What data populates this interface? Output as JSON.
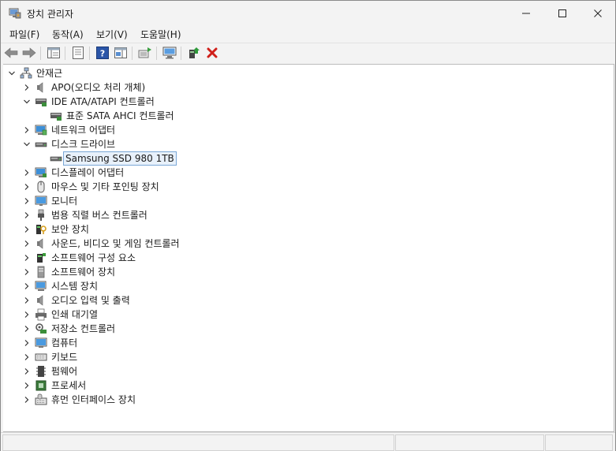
{
  "window": {
    "title": "장치 관리자",
    "icon": "device-manager-icon",
    "controls": [
      "minimize-icon",
      "maximize-icon",
      "close-icon"
    ]
  },
  "menu": [
    {
      "label": "파일(F)"
    },
    {
      "label": "동작(A)"
    },
    {
      "label": "보기(V)"
    },
    {
      "label": "도움말(H)"
    }
  ],
  "toolbar": {
    "buttons": [
      "back-arrow-icon",
      "forward-arrow-icon",
      "show-hide-tree-icon",
      "properties-icon",
      "help-icon",
      "action-pane-icon",
      "update-driver-icon",
      "scan-hardware-icon",
      "add-driver-icon",
      "uninstall-device-icon"
    ]
  },
  "tree": {
    "root": {
      "label": "안재근",
      "icon": "computer-tree-icon",
      "expanded": true
    },
    "nodes": [
      {
        "label": "APO(오디오 처리 개체)",
        "icon": "speaker-icon",
        "level": 1,
        "expanded": false
      },
      {
        "label": "IDE ATA/ATAPI 컨트롤러",
        "icon": "ide-controller-icon",
        "level": 1,
        "expanded": true
      },
      {
        "label": "표준 SATA AHCI 컨트롤러",
        "icon": "ide-controller-icon",
        "level": 2
      },
      {
        "label": "네트워크 어댑터",
        "icon": "network-adapter-icon",
        "level": 1,
        "expanded": false
      },
      {
        "label": "디스크 드라이브",
        "icon": "disk-drive-icon",
        "level": 1,
        "expanded": true
      },
      {
        "label": "Samsung SSD 980 1TB",
        "icon": "disk-drive-icon",
        "level": 2,
        "selected": true
      },
      {
        "label": "디스플레이 어댑터",
        "icon": "display-adapter-icon",
        "level": 1,
        "expanded": false
      },
      {
        "label": "마우스 및 기타 포인팅 장치",
        "icon": "mouse-icon",
        "level": 1,
        "expanded": false
      },
      {
        "label": "모니터",
        "icon": "monitor-icon",
        "level": 1,
        "expanded": false
      },
      {
        "label": "범용 직렬 버스 컨트롤러",
        "icon": "usb-icon",
        "level": 1,
        "expanded": false
      },
      {
        "label": "보안 장치",
        "icon": "security-device-icon",
        "level": 1,
        "expanded": false
      },
      {
        "label": "사운드, 비디오 및 게임 컨트롤러",
        "icon": "speaker-icon",
        "level": 1,
        "expanded": false
      },
      {
        "label": "소프트웨어 구성 요소",
        "icon": "software-component-icon",
        "level": 1,
        "expanded": false
      },
      {
        "label": "소프트웨어 장치",
        "icon": "software-device-icon",
        "level": 1,
        "expanded": false
      },
      {
        "label": "시스템 장치",
        "icon": "system-device-icon",
        "level": 1,
        "expanded": false
      },
      {
        "label": "오디오 입력 및 출력",
        "icon": "speaker-icon",
        "level": 1,
        "expanded": false
      },
      {
        "label": "인쇄 대기열",
        "icon": "printer-icon",
        "level": 1,
        "expanded": false
      },
      {
        "label": "저장소 컨트롤러",
        "icon": "storage-controller-icon",
        "level": 1,
        "expanded": false
      },
      {
        "label": "컴퓨터",
        "icon": "computer-icon",
        "level": 1,
        "expanded": false
      },
      {
        "label": "키보드",
        "icon": "keyboard-icon",
        "level": 1,
        "expanded": false
      },
      {
        "label": "펌웨어",
        "icon": "firmware-icon",
        "level": 1,
        "expanded": false
      },
      {
        "label": "프로세서",
        "icon": "processor-icon",
        "level": 1,
        "expanded": false
      },
      {
        "label": "휴먼 인터페이스 장치",
        "icon": "hid-icon",
        "level": 1,
        "expanded": false
      }
    ]
  },
  "colors": {
    "selection_border": "#7aa7d6",
    "selection_fill": "#e8f1fb",
    "uninstall_red": "#d0201a",
    "tree_bg": "#ffffff",
    "chrome_bg": "#f3f3f3"
  }
}
